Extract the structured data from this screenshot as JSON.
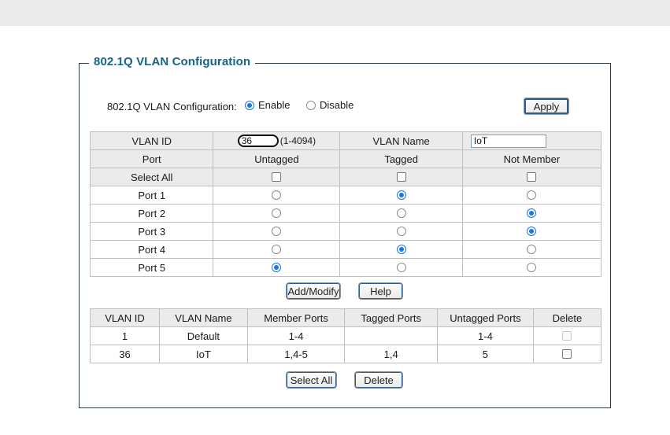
{
  "page": {
    "legend": "802.1Q VLAN Configuration"
  },
  "mode": {
    "label": "802.1Q VLAN Configuration:",
    "enable_label": "Enable",
    "disable_label": "Disable",
    "selected": "Enable",
    "apply_label": "Apply"
  },
  "config": {
    "vlan_id_header": "VLAN ID",
    "vlan_id_value": "36",
    "vlan_id_hint": "(1-4094)",
    "vlan_name_header": "VLAN Name",
    "vlan_name_value": "IoT",
    "vlan_name_placeholder": "",
    "columns": [
      "Port",
      "Untagged",
      "Tagged",
      "Not Member"
    ],
    "select_all_label": "Select All",
    "select_all_checked": [
      false,
      false,
      false
    ],
    "rows": [
      {
        "port": "Port 1",
        "selection": "Tagged"
      },
      {
        "port": "Port 2",
        "selection": "Not Member"
      },
      {
        "port": "Port 3",
        "selection": "Not Member"
      },
      {
        "port": "Port 4",
        "selection": "Tagged"
      },
      {
        "port": "Port 5",
        "selection": "Untagged"
      }
    ]
  },
  "mid_buttons": {
    "add_modify_label": "Add/Modify",
    "help_label": "Help"
  },
  "summary": {
    "columns": [
      "VLAN ID",
      "VLAN Name",
      "Member Ports",
      "Tagged Ports",
      "Untagged Ports",
      "Delete"
    ],
    "rows": [
      {
        "vlan_id": "1",
        "vlan_name": "Default",
        "member_ports": "1-4",
        "tagged_ports": "",
        "untagged_ports": "1-4",
        "delete_checked": false,
        "delete_disabled": true
      },
      {
        "vlan_id": "36",
        "vlan_name": "IoT",
        "member_ports": "1,4-5",
        "tagged_ports": "1,4",
        "untagged_ports": "5",
        "delete_checked": false,
        "delete_disabled": false
      }
    ]
  },
  "bottom_buttons": {
    "select_all_label": "Select All",
    "delete_label": "Delete"
  },
  "colors": {
    "legend": "#17638a",
    "border": "#2b3a42",
    "header_bg": "#ebebeb",
    "accent_radio": "#1577e8",
    "top_band": "#eaeaea"
  }
}
